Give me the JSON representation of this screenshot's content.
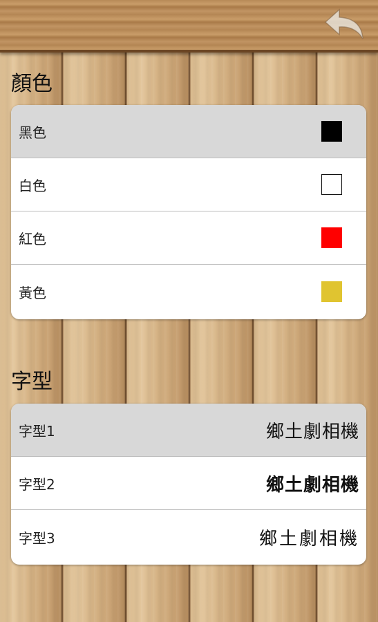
{
  "header": {
    "back_icon": "back-arrow-icon"
  },
  "color_section": {
    "title": "顏色",
    "selected_index": 0,
    "options": [
      {
        "label": "黑色",
        "color": "#000000"
      },
      {
        "label": "白色",
        "color": "#ffffff"
      },
      {
        "label": "紅色",
        "color": "#ff0000"
      },
      {
        "label": "黃色",
        "color": "#e0c430"
      }
    ]
  },
  "font_section": {
    "title": "字型",
    "selected_index": 0,
    "options": [
      {
        "label": "字型1",
        "sample": "鄉土劇相機"
      },
      {
        "label": "字型2",
        "sample": "鄉土劇相機"
      },
      {
        "label": "字型3",
        "sample": "鄉土劇相機"
      }
    ]
  }
}
